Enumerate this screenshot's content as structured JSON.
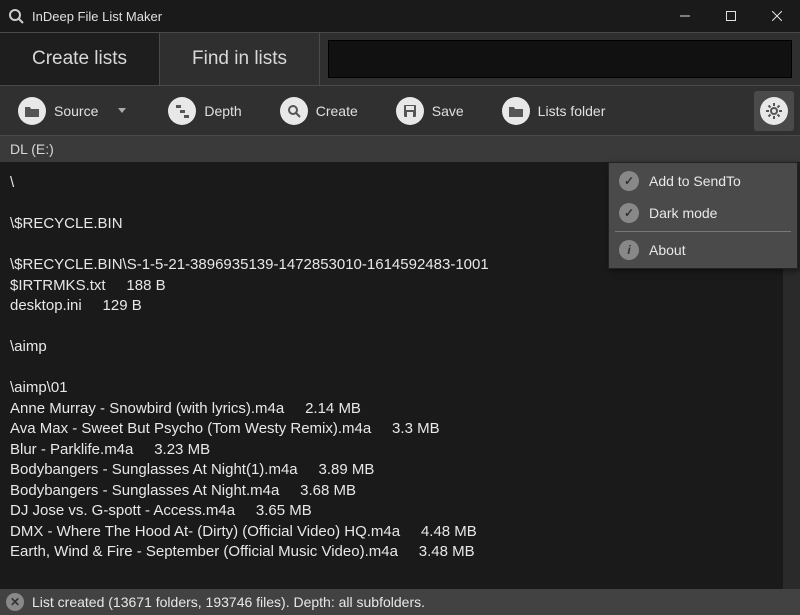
{
  "window": {
    "title": "InDeep File List Maker"
  },
  "tabs": {
    "create": "Create lists",
    "find": "Find in lists"
  },
  "toolbar": {
    "source": "Source",
    "depth": "Depth",
    "create": "Create",
    "save": "Save",
    "lists": "Lists folder"
  },
  "path": "DL (E:)",
  "popup": {
    "sendto": "Add to SendTo",
    "darkmode": "Dark mode",
    "about": "About"
  },
  "status": "List created (13671 folders, 193746 files).  Depth: all subfolders.",
  "lines": [
    "\\",
    "",
    "\\$RECYCLE.BIN",
    "",
    "\\$RECYCLE.BIN\\S-1-5-21-3896935139-1472853010-1614592483-1001",
    "$IRTRMKS.txt     188 B",
    "desktop.ini     129 B",
    "",
    "\\aimp",
    "",
    "\\aimp\\01",
    "Anne Murray - Snowbird (with lyrics).m4a     2.14 MB",
    "Ava Max - Sweet But Psycho (Tom Westy Remix).m4a     3.3 MB",
    "Blur - Parklife.m4a     3.23 MB",
    "Bodybangers - Sunglasses At Night(1).m4a     3.89 MB",
    "Bodybangers - Sunglasses At Night.m4a     3.68 MB",
    "DJ Jose vs. G-spott - Access.m4a     3.65 MB",
    "DMX - Where The Hood At- (Dirty) (Official Video) HQ.m4a     4.48 MB",
    "Earth, Wind & Fire - September (Official Music Video).m4a     3.48 MB"
  ]
}
